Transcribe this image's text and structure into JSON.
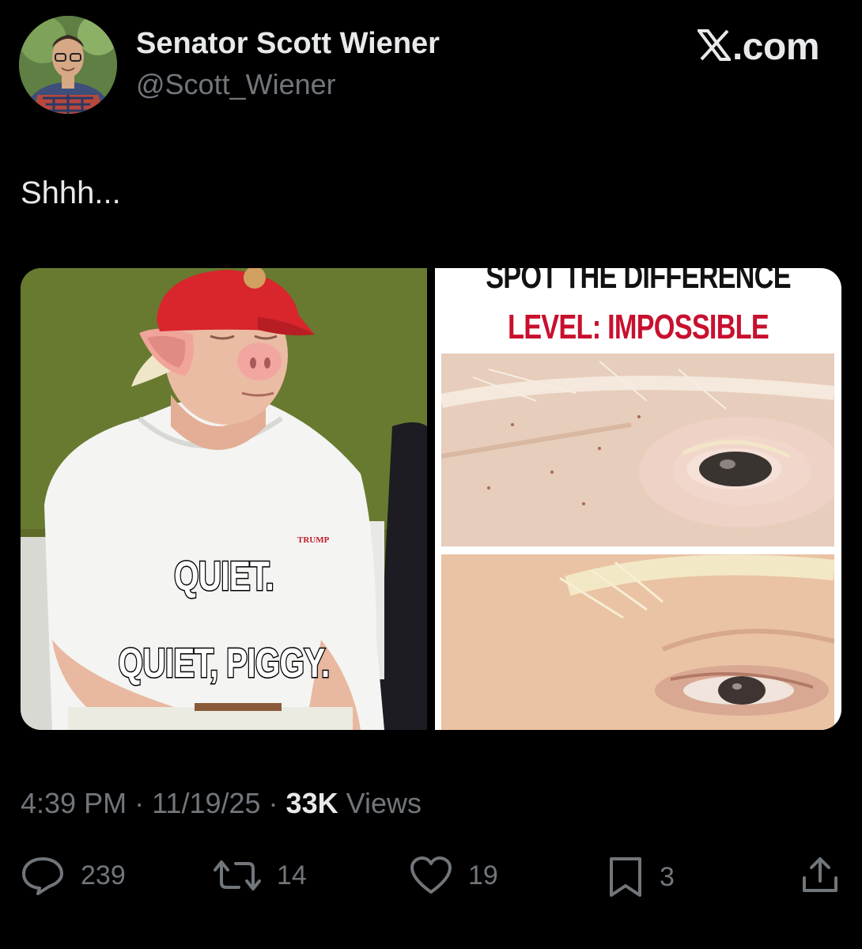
{
  "author": {
    "display_name": "Senator Scott Wiener",
    "handle": "@Scott_Wiener"
  },
  "site_logo": {
    "icon": "x-logo-icon",
    "text": ".com"
  },
  "tweet": {
    "text": "Shhh..."
  },
  "media": {
    "left": {
      "caption_line1": "QUIET.",
      "caption_line2": "QUIET, PIGGY.",
      "shirt_logo": "TRUMP"
    },
    "right": {
      "title": "SPOT THE DIFFERENCE",
      "level": "LEVEL: IMPOSSIBLE"
    }
  },
  "meta": {
    "time": "4:39 PM",
    "sep1": " · ",
    "date": "11/19/25",
    "sep2": " · ",
    "views_count": "33K",
    "views_label": " Views"
  },
  "actions": {
    "replies": {
      "icon": "reply-icon",
      "count": "239"
    },
    "reposts": {
      "icon": "repost-icon",
      "count": "14"
    },
    "likes": {
      "icon": "heart-icon",
      "count": "19"
    },
    "bookmarks": {
      "icon": "bookmark-icon",
      "count": "3"
    },
    "share": {
      "icon": "share-icon"
    }
  },
  "colors": {
    "background": "#000000",
    "text_primary": "#e7e9ea",
    "text_secondary": "#71767b",
    "meme_level_red": "#c8102e"
  }
}
